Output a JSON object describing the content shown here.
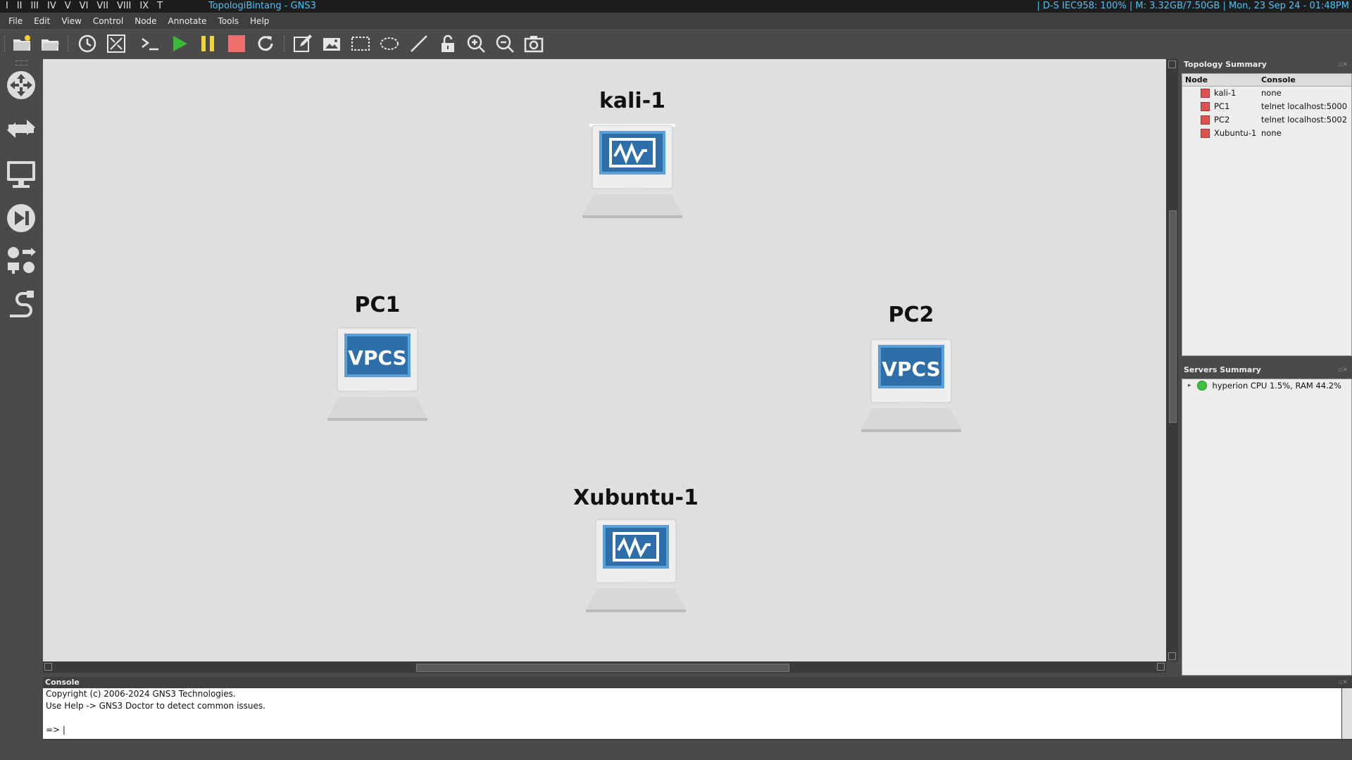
{
  "os_bar": {
    "workspaces": [
      "I",
      "II",
      "III",
      "IV",
      "V",
      "VI",
      "VII",
      "VIII",
      "IX",
      "T"
    ],
    "window_title": "TopologiBintang - GNS3",
    "status": "| D-S IEC958: 100% | M: 3.32GB/7.50GB | Mon, 23 Sep 24 - 01:48PM"
  },
  "menu": [
    "File",
    "Edit",
    "View",
    "Control",
    "Node",
    "Annotate",
    "Tools",
    "Help"
  ],
  "toolbar_icons": [
    "new-project-icon",
    "open-project-icon",
    "snapshot-icon",
    "show-interface-labels-icon",
    "console-all-icon",
    "start-all-icon",
    "suspend-all-icon",
    "stop-all-icon",
    "reload-all-icon",
    "add-note-icon",
    "insert-picture-icon",
    "draw-rectangle-icon",
    "draw-ellipse-icon",
    "draw-line-icon",
    "lock-unlock-icon",
    "zoom-in-icon",
    "zoom-out-icon",
    "screenshot-icon"
  ],
  "nodes": [
    {
      "id": "kali",
      "label": "kali-1",
      "type": "qemu"
    },
    {
      "id": "pc1",
      "label": "PC1",
      "type": "vpcs",
      "screen_text": "VPCS"
    },
    {
      "id": "pc2",
      "label": "PC2",
      "type": "vpcs",
      "screen_text": "VPCS"
    },
    {
      "id": "xubuntu",
      "label": "Xubuntu-1",
      "type": "qemu"
    }
  ],
  "topology_summary": {
    "title": "Topology Summary",
    "col_node": "Node",
    "col_console": "Console",
    "rows": [
      {
        "node": "kali-1",
        "console": "none"
      },
      {
        "node": "PC1",
        "console": "telnet localhost:5000"
      },
      {
        "node": "PC2",
        "console": "telnet localhost:5002"
      },
      {
        "node": "Xubuntu-1",
        "console": "none"
      }
    ]
  },
  "servers_summary": {
    "title": "Servers Summary",
    "row": "hyperion CPU 1.5%, RAM 44.2%"
  },
  "console": {
    "title": "Console",
    "lines": [
      "Copyright (c) 2006-2024 GNS3 Technologies.",
      "Use Help -> GNS3 Doctor to detect common issues.",
      "",
      "=> |"
    ]
  },
  "colors": {
    "accent": "#4fc3f7",
    "start": "#3db83d",
    "suspend": "#f0d23a",
    "stop": "#f07070",
    "arrow": "#e01010",
    "status_dot": "#3cc23c",
    "node_status": "#e05050"
  }
}
